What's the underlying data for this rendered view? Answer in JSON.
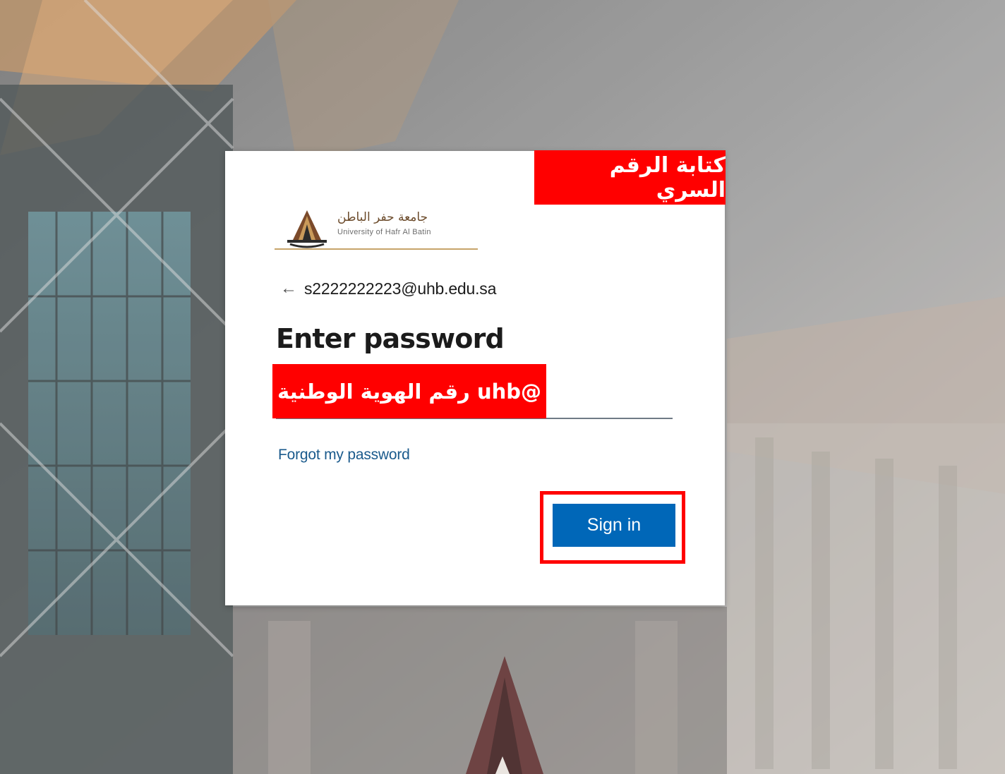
{
  "annotations": {
    "top_banner": "كتابة الرقم السري",
    "password_banner": "@uhb   رقم الهوية الوطنية"
  },
  "branding": {
    "arabic_name": "جامعة حفر الباطن",
    "english_name": "University of Hafr Al Batin"
  },
  "account": {
    "identity": "s2222222223@uhb.edu.sa",
    "back_label": "←"
  },
  "form": {
    "title": "Enter password",
    "password_placeholder": "",
    "forgot_label": "Forgot my password",
    "signin_label": "Sign in"
  },
  "colors": {
    "annotation_red": "#ff0000",
    "primary_button": "#0067b8",
    "link": "#1a5a8c"
  }
}
